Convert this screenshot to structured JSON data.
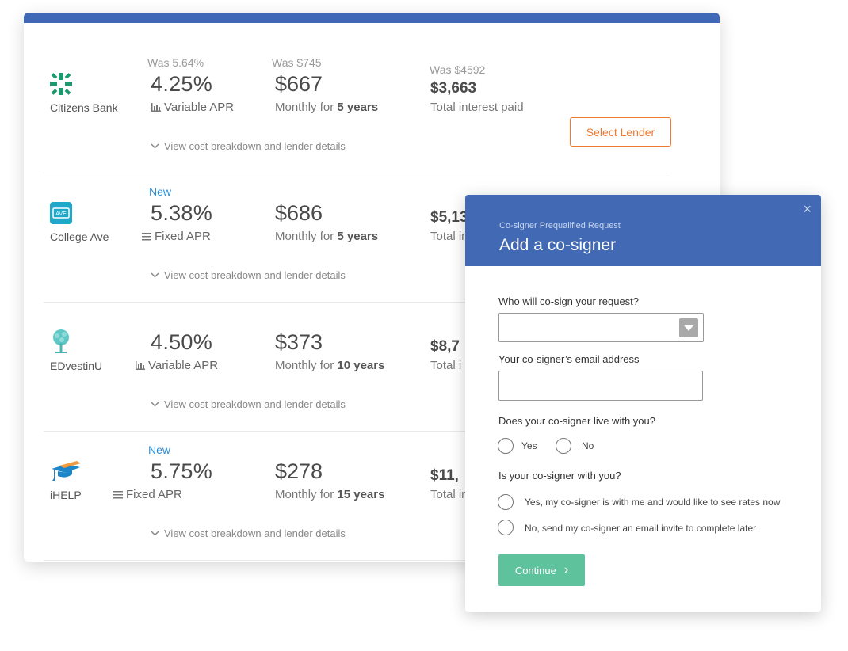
{
  "lenders": [
    {
      "name": "Citizens Bank",
      "logo": "citizens-bank-logo",
      "was_rate": "Was ",
      "was_rate_old": "5.64%",
      "rate": "4.25%",
      "apr_icon": "chart-bars-icon",
      "apr_type": "Variable APR",
      "was_monthly": "Was $",
      "was_monthly_old": "745",
      "monthly": "$667",
      "term_prefix": "Monthly for ",
      "term": "5 years",
      "was_interest": "Was $",
      "was_interest_old": "4592",
      "interest": "$3,663",
      "interest_label": "Total interest paid",
      "select_label": "Select Lender",
      "details": "View cost breakdown and lender details"
    },
    {
      "name": "College Ave",
      "logo": "college-ave-logo",
      "badge": "New",
      "rate": "5.38%",
      "apr_icon": "lines-icon",
      "apr_type": "Fixed APR",
      "monthly": "$686",
      "term_prefix": "Monthly for ",
      "term": "5 years",
      "interest": "$5,13",
      "interest_label": "Total in",
      "details": "View cost breakdown and lender details"
    },
    {
      "name": "EDvestinU",
      "logo": "edvestinu-tree-logo",
      "rate": "4.50%",
      "apr_icon": "chart-bars-icon",
      "apr_type": "Variable APR",
      "monthly": "$373",
      "term_prefix": "Monthly for ",
      "term": "10 years",
      "interest": "$8,7",
      "interest_label": "Total i",
      "details": "View cost breakdown and lender details"
    },
    {
      "name": "iHELP",
      "logo": "ihelp-graduation-cap-logo",
      "badge": "New",
      "rate": "5.75%",
      "apr_icon": "lines-icon",
      "apr_type": "Fixed APR",
      "monthly": "$278",
      "term_prefix": "Monthly for ",
      "term": "15 years",
      "interest": "$11,",
      "interest_label": "Total in",
      "details": "View cost breakdown and lender details"
    }
  ],
  "modal": {
    "subtitle": "Co-signer Prequalified Request",
    "title": "Add a co-signer",
    "close": "×",
    "q1": "Who will co-sign your request?",
    "q1_value": "",
    "q2": "Your co-signer’s email address",
    "q2_value": "",
    "q3": "Does your co-signer live with you?",
    "q3_yes": "Yes",
    "q3_no": "No",
    "q4": "Is your co-signer with you?",
    "q4_opt1": "Yes, my co-signer is with me and would like to see rates now",
    "q4_opt2": "No, send my co-signer an email invite to complete later",
    "continue": "Continue",
    "continue_icon": "›"
  },
  "colors": {
    "header_blue": "#3f68b7",
    "accent_orange": "#ef7a2f",
    "badge_blue": "#2f8fd6",
    "continue_green": "#5ec39d"
  }
}
